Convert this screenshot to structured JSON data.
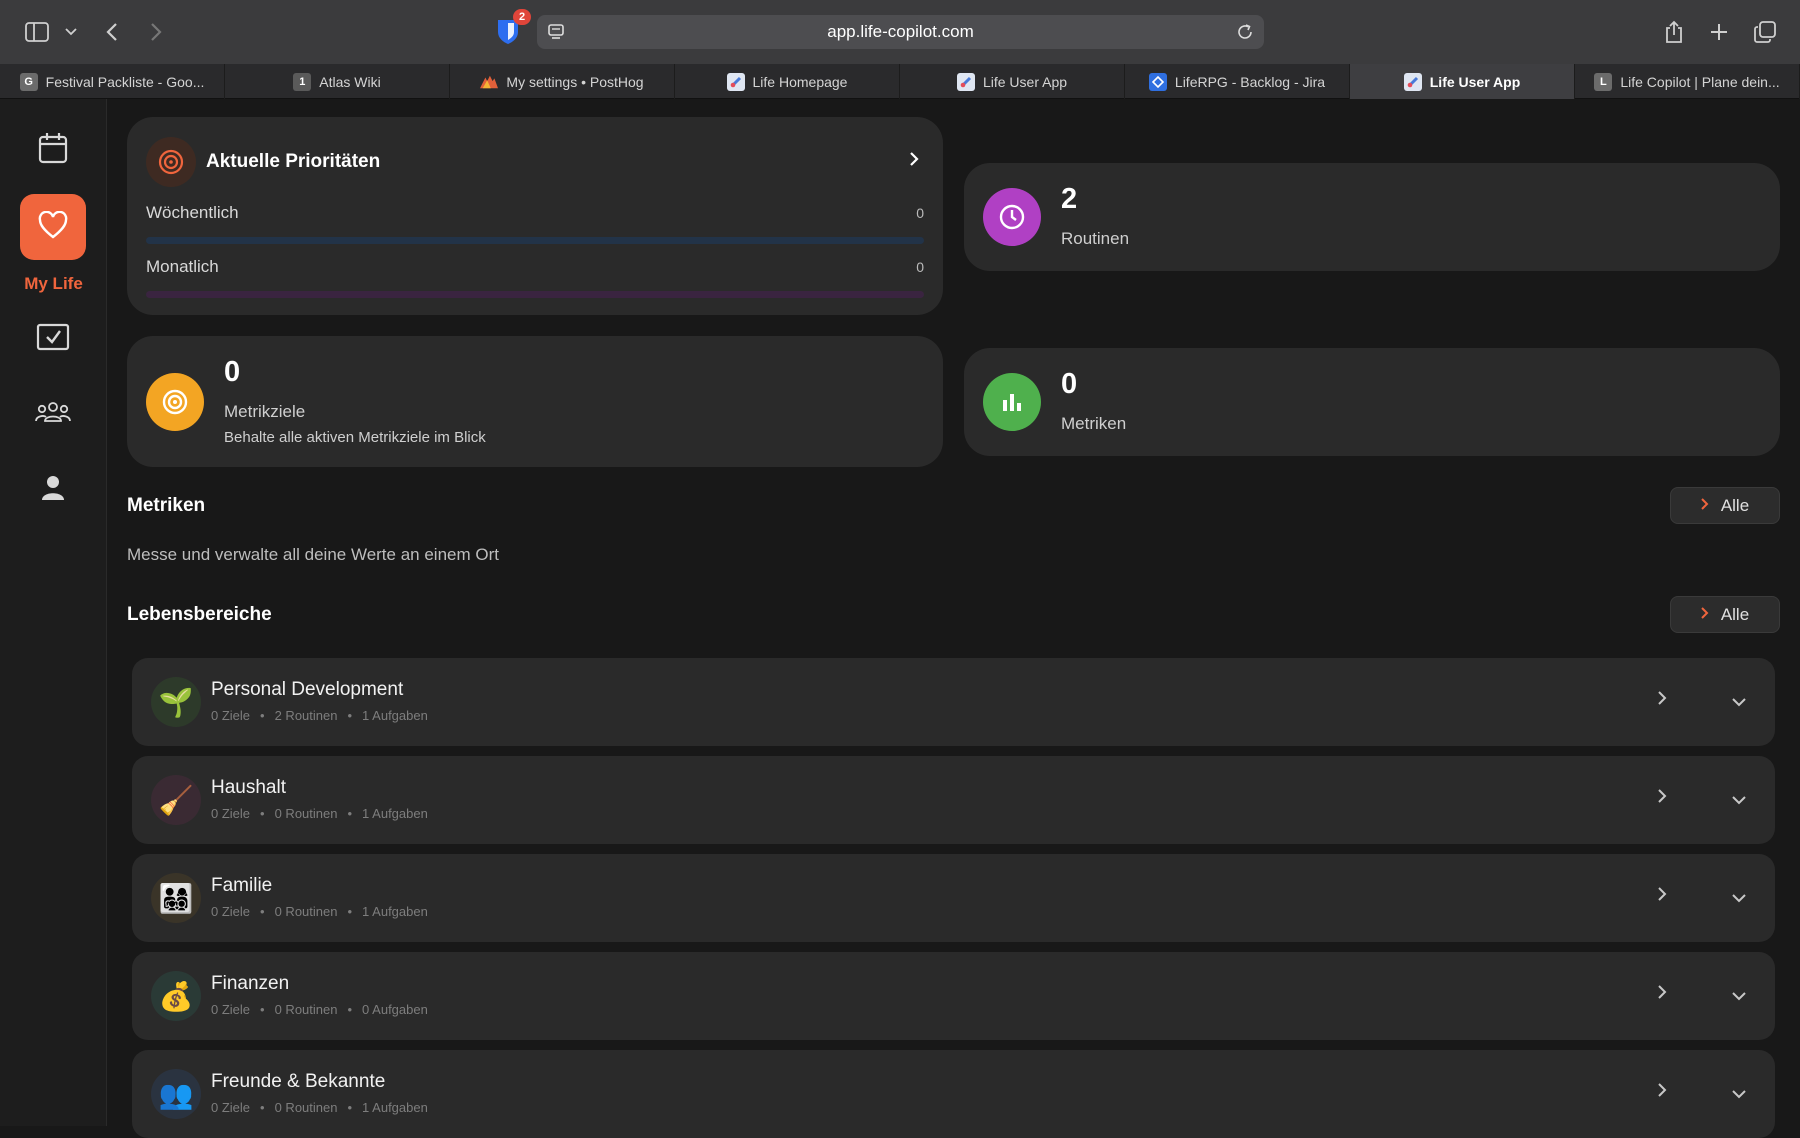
{
  "browser": {
    "url": "app.life-copilot.com",
    "extension_badge": "2",
    "tabs": [
      {
        "label": "Festival Packliste - Goo...",
        "fav": "G",
        "color": "#6b6b6b",
        "active": false
      },
      {
        "label": "Atlas Wiki",
        "fav": "1",
        "color": "#5a5a5a",
        "active": false
      },
      {
        "label": "My settings • PostHog",
        "fav": "",
        "color": "#e2603a",
        "active": false
      },
      {
        "label": "Life Homepage",
        "fav": "",
        "color": "#dfe6f2",
        "active": false
      },
      {
        "label": "Life User App",
        "fav": "",
        "color": "#dfe6f2",
        "active": false
      },
      {
        "label": "LifeRPG - Backlog - Jira",
        "fav": "",
        "color": "#2f6fe0",
        "active": false
      },
      {
        "label": "Life User App",
        "fav": "",
        "color": "#dfe6f2",
        "active": true
      },
      {
        "label": "Life Copilot | Plane dein...",
        "fav": "L",
        "color": "#6b6b6b",
        "active": false
      }
    ]
  },
  "sidebar": {
    "active_label": "My Life",
    "items": [
      "calendar-icon",
      "heart-icon",
      "checkbox-icon",
      "group-icon",
      "person-icon"
    ]
  },
  "priorities": {
    "title": "Aktuelle Prioritäten",
    "rows": [
      {
        "label": "Wöchentlich",
        "value": "0",
        "color": "#223348"
      },
      {
        "label": "Monatlich",
        "value": "0",
        "color": "#3a2440"
      }
    ]
  },
  "stats": {
    "routinen": {
      "value": "2",
      "label": "Routinen",
      "color": "#b040c4"
    },
    "metrikziele": {
      "value": "0",
      "label": "Metrikziele",
      "sub": "Behalte alle aktiven Metrikziele im Blick",
      "color": "#f3a523"
    },
    "metriken": {
      "value": "0",
      "label": "Metriken",
      "color": "#4fb04d"
    }
  },
  "metriken_section": {
    "title": "Metriken",
    "desc": "Messe und verwalte all deine Werte an einem Ort",
    "button": "Alle"
  },
  "areas_section": {
    "title": "Lebensbereiche",
    "button": "Alle",
    "items": [
      {
        "name": "Personal Development",
        "emoji": "🌱",
        "bg": "#2d3a2a",
        "ziele": "0 Ziele",
        "routinen": "2 Routinen",
        "aufgaben": "1 Aufgaben"
      },
      {
        "name": "Haushalt",
        "emoji": "🧹",
        "bg": "#3a2a33",
        "ziele": "0 Ziele",
        "routinen": "0 Routinen",
        "aufgaben": "1 Aufgaben"
      },
      {
        "name": "Familie",
        "emoji": "👨‍👩‍👧‍👦",
        "bg": "#3a3428",
        "ziele": "0 Ziele",
        "routinen": "0 Routinen",
        "aufgaben": "1 Aufgaben"
      },
      {
        "name": "Finanzen",
        "emoji": "💰",
        "bg": "#2a3a36",
        "ziele": "0 Ziele",
        "routinen": "0 Routinen",
        "aufgaben": "0 Aufgaben"
      },
      {
        "name": "Freunde & Bekannte",
        "emoji": "👥",
        "bg": "#2a3340",
        "ziele": "0 Ziele",
        "routinen": "0 Routinen",
        "aufgaben": "1 Aufgaben"
      }
    ]
  }
}
